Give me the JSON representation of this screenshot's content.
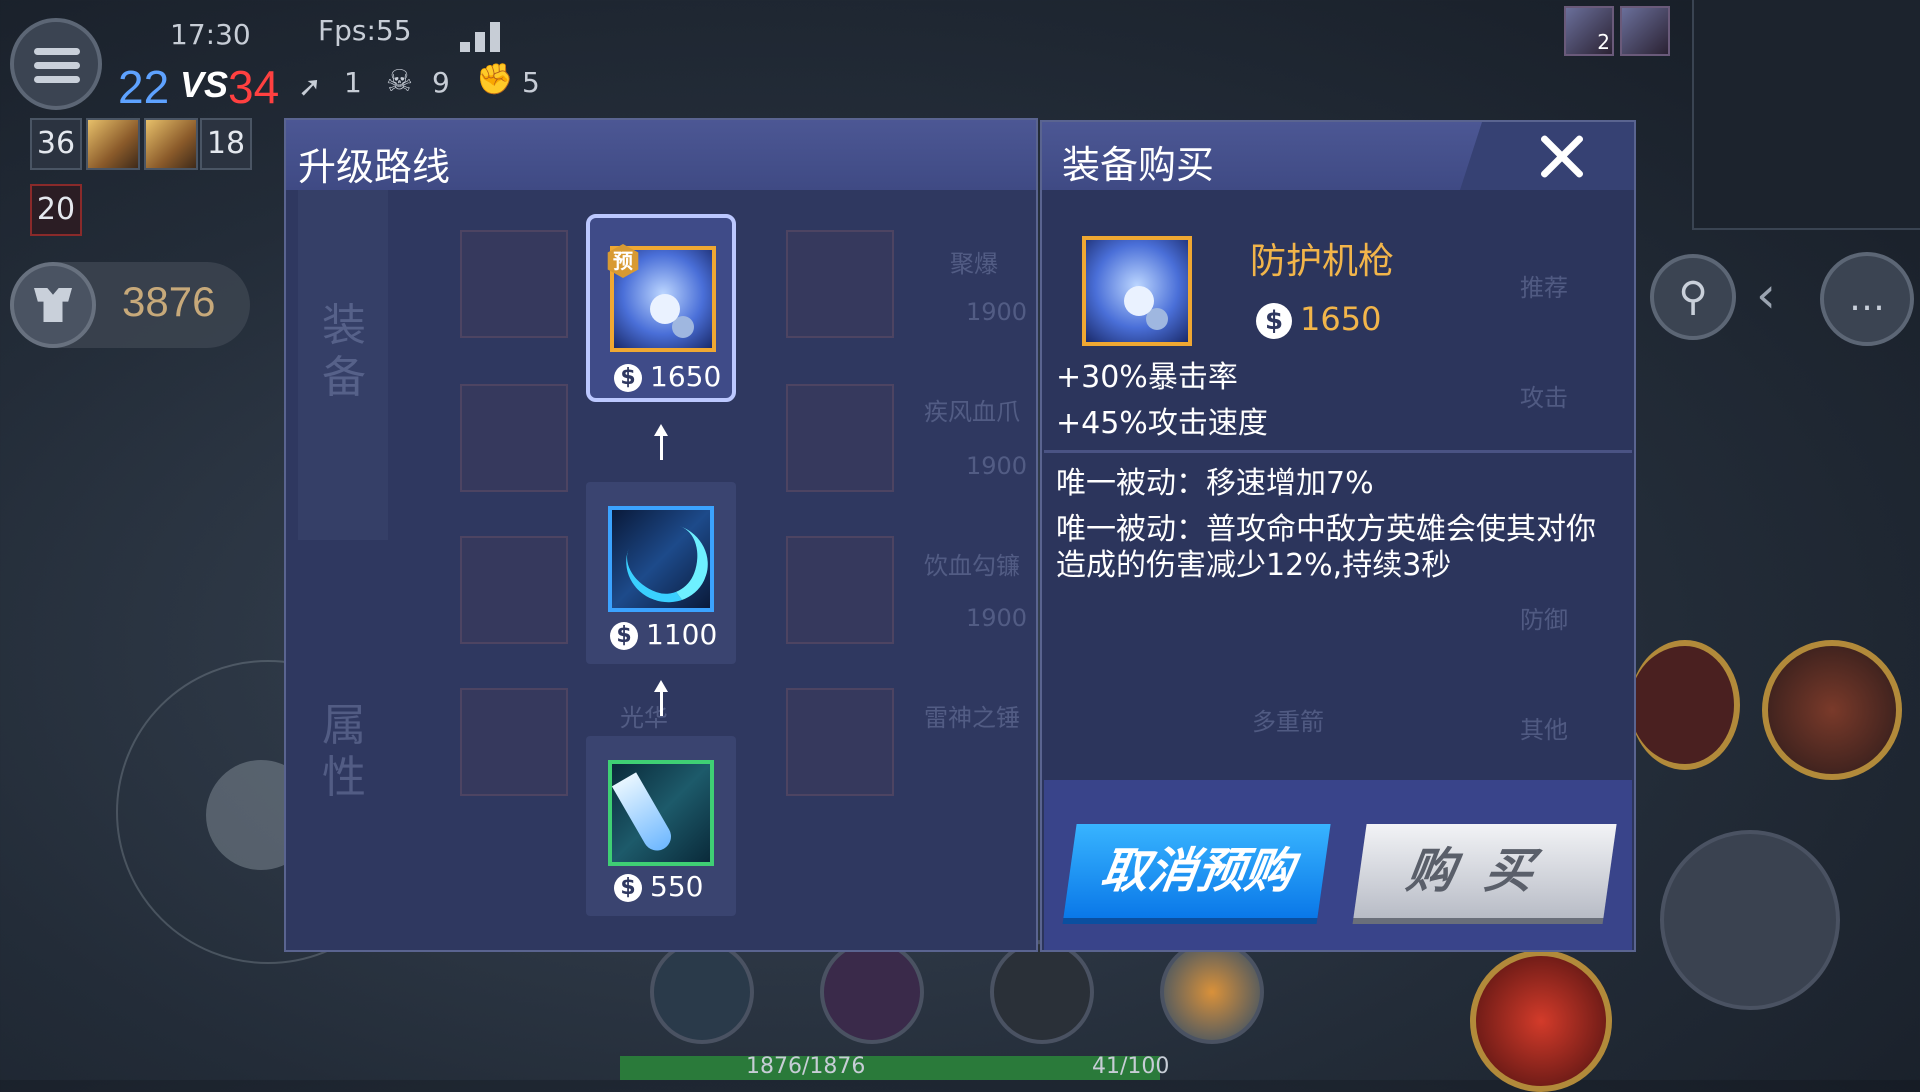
{
  "hud": {
    "time": "17:30",
    "fps": "Fps:55",
    "score_blue": "22",
    "vs": "VS",
    "score_red": "34",
    "stat_kills": "1",
    "stat_deaths": "9",
    "stat_assists": "5",
    "team_left_level": "36",
    "team_right_level": "18",
    "respawn_timer": "20",
    "gold": "3876",
    "kill_feed_count": "2",
    "hp": "1876/1876",
    "mana": "41/100"
  },
  "upgrade_panel": {
    "title": "升级路线",
    "ghost_side_top": "装备",
    "ghost_side_bottom": "属性",
    "ghost_names": [
      "聚爆",
      "疾风血爪",
      "饮血勾镰",
      "雷神之锤",
      "光华"
    ],
    "ghost_price": "1900",
    "route": [
      {
        "price": "1650",
        "badge": "预",
        "icon": "shield-gun-icon"
      },
      {
        "price": "1100",
        "icon": "crescent-blade-icon"
      },
      {
        "price": "550",
        "icon": "dagger-icon"
      }
    ]
  },
  "purchase_panel": {
    "title": "装备购买",
    "ghost_tabs": [
      "推荐",
      "攻击",
      "防御",
      "其他"
    ],
    "ghost_name": "多重箭",
    "item_name": "防护机枪",
    "item_price": "1650",
    "stats": [
      "+30%暴击率",
      "+45%攻击速度"
    ],
    "passive_1": "唯一被动：移速增加7%",
    "passive_2_line1": "唯一被动：普攻命中敌方英雄会使其对你",
    "passive_2_line2": "造成的伤害减少12%,持续3秒",
    "cancel_label": "取消预购",
    "buy_label": "购买"
  },
  "currency_symbol": "$"
}
